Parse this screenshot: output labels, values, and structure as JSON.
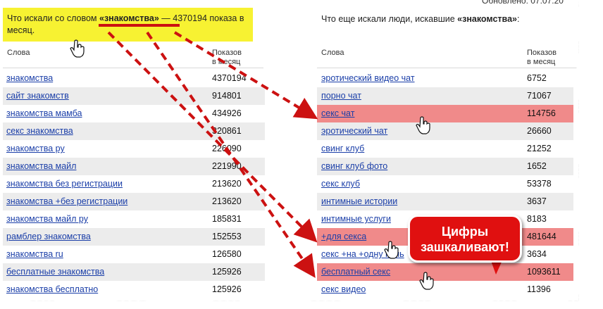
{
  "header": {
    "updated_text": "Обновлено: 07.07.20",
    "left_prefix": "Что искали со словом ",
    "keyword_quoted": "«знакомства»",
    "left_suffix": " — 4370194 показа в месяц.",
    "right_prefix": "Что еще искали люди, искавшие ",
    "right_suffix": ":"
  },
  "columns": {
    "words": "Слова",
    "shows_line1": "Показов",
    "shows_line2": "в месяц"
  },
  "left_rows": [
    {
      "query": "знакомства",
      "count": "4370194"
    },
    {
      "query": "сайт знакомств",
      "count": "914801"
    },
    {
      "query": "знакомства мамба",
      "count": "434926"
    },
    {
      "query": "секс знакомства",
      "count": "320861"
    },
    {
      "query": "знакомства ру",
      "count": "226090"
    },
    {
      "query": "знакомства майл",
      "count": "221990"
    },
    {
      "query": "знакомства без регистрации",
      "count": "213620"
    },
    {
      "query": "знакомства +без регистрации",
      "count": "213620"
    },
    {
      "query": "знакомства майл ру",
      "count": "185831"
    },
    {
      "query": "рамблер знакомства",
      "count": "152553"
    },
    {
      "query": "знакомства ru",
      "count": "126580"
    },
    {
      "query": "бесплатные знакомства",
      "count": "125926"
    },
    {
      "query": "знакомства бесплатно",
      "count": "125926"
    }
  ],
  "right_rows": [
    {
      "query": "эротический видео чат",
      "count": "6752"
    },
    {
      "query": "порно чат",
      "count": "71067"
    },
    {
      "query": "секс чат",
      "count": "114756"
    },
    {
      "query": "эротический чат",
      "count": "26660"
    },
    {
      "query": "свинг клуб",
      "count": "21252"
    },
    {
      "query": "свинг клуб фото",
      "count": "1652"
    },
    {
      "query": "секс клуб",
      "count": "53378"
    },
    {
      "query": "интимные истории",
      "count": "3637"
    },
    {
      "query": "интимные услуги",
      "count": "8183"
    },
    {
      "query": "+для секса",
      "count": "481644"
    },
    {
      "query": "секс +на +одну ночь",
      "count": "3634"
    },
    {
      "query": "бесплатный секс",
      "count": "1093611"
    },
    {
      "query": "секс видео",
      "count": "11396"
    }
  ],
  "callout": {
    "line1": "Цифры",
    "line2": "зашкаливают!"
  },
  "colors": {
    "highlight": "#f7f232",
    "row_alt": "#ececec",
    "row_red": "#f08a8a",
    "arrow": "#cc1111",
    "link": "#1a3ea8"
  }
}
